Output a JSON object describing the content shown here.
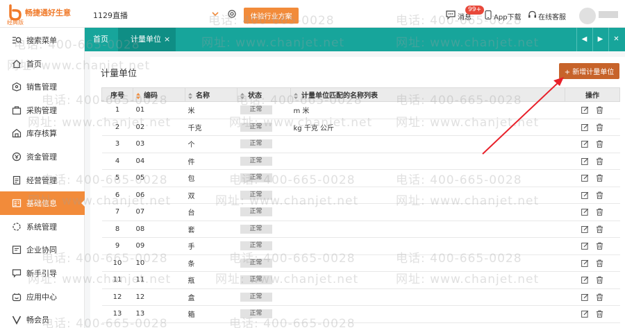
{
  "header": {
    "logo_text": "畅捷通好生意",
    "logo_sub": "经典版",
    "company": "1129直播",
    "industry_button": "体验行业方案",
    "messages_label": "消息",
    "messages_badge": "99+",
    "app_download": "App下载",
    "online_service": "在线客服"
  },
  "sidebar": {
    "items": [
      {
        "label": "搜索菜单",
        "icon": "search-menu-icon"
      },
      {
        "label": "首页",
        "icon": "home-icon"
      },
      {
        "label": "销售管理",
        "icon": "sales-icon"
      },
      {
        "label": "采购管理",
        "icon": "purchase-icon"
      },
      {
        "label": "库存核算",
        "icon": "inventory-icon"
      },
      {
        "label": "资金管理",
        "icon": "money-icon"
      },
      {
        "label": "经营管理",
        "icon": "operation-icon"
      },
      {
        "label": "基础信息",
        "icon": "basic-info-icon",
        "active": true
      },
      {
        "label": "系统管理",
        "icon": "system-icon"
      },
      {
        "label": "企业协同",
        "icon": "collab-icon"
      },
      {
        "label": "新手引导",
        "icon": "guide-icon"
      },
      {
        "label": "应用中心",
        "icon": "app-center-icon"
      },
      {
        "label": "畅会员",
        "icon": "member-icon"
      }
    ]
  },
  "tabs": {
    "home": "首页",
    "active": "计量单位",
    "close": "×",
    "prev": "◀",
    "next": "▶",
    "close_all": "✕"
  },
  "page": {
    "title": "计量单位",
    "add_button": "+ 新增计量单位"
  },
  "table": {
    "headers": [
      "序号",
      "编码",
      "名称",
      "状态",
      "计量单位匹配的名称列表",
      "操作"
    ],
    "rows": [
      {
        "idx": "1",
        "code": "01",
        "name": "米",
        "status": "正常",
        "aliases": "m 米"
      },
      {
        "idx": "2",
        "code": "02",
        "name": "千克",
        "status": "正常",
        "aliases": "kg 千克 公斤"
      },
      {
        "idx": "3",
        "code": "03",
        "name": "个",
        "status": "正常",
        "aliases": ""
      },
      {
        "idx": "4",
        "code": "04",
        "name": "件",
        "status": "正常",
        "aliases": ""
      },
      {
        "idx": "5",
        "code": "05",
        "name": "包",
        "status": "正常",
        "aliases": ""
      },
      {
        "idx": "6",
        "code": "06",
        "name": "双",
        "status": "正常",
        "aliases": ""
      },
      {
        "idx": "7",
        "code": "07",
        "name": "台",
        "status": "正常",
        "aliases": ""
      },
      {
        "idx": "8",
        "code": "08",
        "name": "套",
        "status": "正常",
        "aliases": ""
      },
      {
        "idx": "9",
        "code": "09",
        "name": "手",
        "status": "正常",
        "aliases": ""
      },
      {
        "idx": "10",
        "code": "10",
        "name": "条",
        "status": "正常",
        "aliases": ""
      },
      {
        "idx": "11",
        "code": "11",
        "name": "瓶",
        "status": "正常",
        "aliases": ""
      },
      {
        "idx": "12",
        "code": "12",
        "name": "盒",
        "status": "正常",
        "aliases": ""
      },
      {
        "idx": "13",
        "code": "13",
        "name": "箱",
        "status": "正常",
        "aliases": ""
      }
    ]
  },
  "watermark": {
    "phone": "电话: 400-665-0028",
    "site": "网址: www.chanjet.net"
  },
  "colors": {
    "accent_orange": "#f28b3a",
    "add_button": "#c7632a",
    "tab_teal": "#17a59b",
    "badge_red": "#e8483a"
  }
}
